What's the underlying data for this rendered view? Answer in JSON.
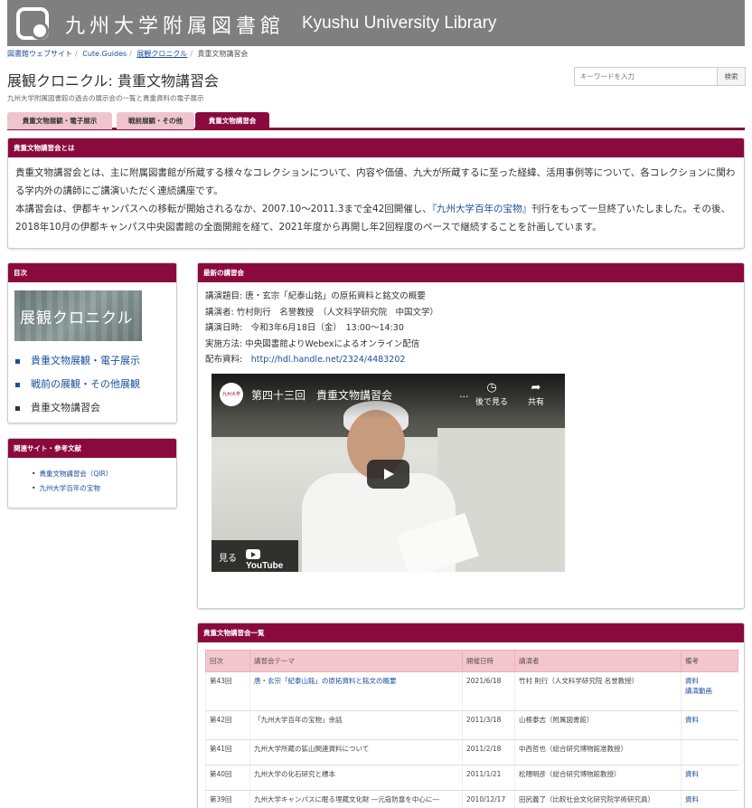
{
  "header": {
    "logo_jp": "九州大学附属図書館",
    "logo_en": "Kyushu University Library"
  },
  "breadcrumb": [
    "図書館ウェブサイト",
    "Cute.Guides",
    "展観クロニクル",
    "貴重文物講習会"
  ],
  "page": {
    "title": "展観クロニクル: 貴重文物講習会",
    "description": "九州大学附属図書館の過去の展示会の一覧と貴重資料の電子展示"
  },
  "search": {
    "placeholder": "キーワードを入力",
    "button_label": "検索"
  },
  "tabs": [
    {
      "label": "貴重文物展観・電子展示",
      "active": false
    },
    {
      "label": "戦前展観・その他",
      "active": false
    },
    {
      "label": "貴重文物講習会",
      "active": true
    }
  ],
  "about": {
    "heading": "貴重文物講習会とは",
    "paragraph1": "貴重文物講習会とは、主に附属図書館が所蔵する様々なコレクションについて、内容や価値、九大が所蔵するに至った経緯、活用事例等について、各コレクションに関わる学内外の講師にご講演いただく連続講座です。",
    "paragraph2_a": "本講習会は、伊都キャンパスへの移転が開始されるなか、2007.10～2011.3まで全42回開催し、",
    "paragraph2_link": "『九州大学百年の宝物』",
    "paragraph2_b": "刊行をもって一旦終了いたしました。その後、2018年10月の伊都キャンパス中央図書館の全面開館を経て、2021年度から再開し年2回程度のペースで継続することを計画しています。"
  },
  "toc": {
    "heading": "目次",
    "banner_text": "展観クロニクル",
    "items": [
      {
        "label": "貴重文物展観・電子展示",
        "current": false
      },
      {
        "label": "戦前の展観・その他展観",
        "current": false
      },
      {
        "label": "貴重文物講習会",
        "current": true
      }
    ]
  },
  "related": {
    "heading": "関連サイト・参考文献",
    "items": [
      "貴重文物講習会（QIR）",
      "九州大学百年の宝物"
    ]
  },
  "latest": {
    "heading": "最新の講習会",
    "topic": "講演題目: 唐・玄宗「紀泰山銘」の原拓資料と銘文の概要",
    "lecturer": "講演者: 竹村則行　名誉教授　（人文科学研究院　中国文学）",
    "datetime": "講演日時:　令和3年6月18日（金）　13:00～14:30",
    "method": "実施方法: 中央図書館よりWebexによるオンライン配信",
    "material_label": "配布資料:",
    "material_link": "http://hdl.handle.net/2324/4483202",
    "video": {
      "channel_logo": "九州大学",
      "title": "第四十三回　貴重文物講習会",
      "more": "...",
      "watch_later": "後で見る",
      "share": "共有",
      "watch_on": "見る",
      "youtube": "YouTube"
    }
  },
  "list": {
    "heading": "貴重文物講習会一覧",
    "columns": [
      "回次",
      "講習会テーマ",
      "開催日時",
      "講演者",
      "備考"
    ],
    "rows": [
      {
        "no": "第43回",
        "theme": "唐・玄宗「紀泰山銘」の原拓資料と銘文の概要",
        "date": "2021/6/18",
        "speaker": "竹村 則行（人文科学研究院 名誉教授）",
        "note1": "資料",
        "note2": "講演動画",
        "theme_link": true
      },
      {
        "no": "第42回",
        "theme": "「九州大学百年の宝物」余話",
        "date": "2011/3/18",
        "speaker": "山根泰志（附属図書館）",
        "note1": "資料",
        "note2": "",
        "theme_link": false
      },
      {
        "no": "第41回",
        "theme": "九州大学所蔵の鉱山関連資料について",
        "date": "2011/2/18",
        "speaker": "中西哲也（総合研究博物館准教授）",
        "note1": "",
        "note2": "",
        "theme_link": false
      },
      {
        "no": "第40回",
        "theme": "九州大学の化石研究と標本",
        "date": "2011/1/21",
        "speaker": "松隈明彦（総合研究博物館教授）",
        "note1": "資料",
        "note2": "",
        "theme_link": false
      },
      {
        "no": "第39回",
        "theme": "九州大学キャンパスに眠る埋蔵文化財 ―元寇防塁を中心に―",
        "date": "2010/12/17",
        "speaker": "田尻義了（比較社会文化研究院学術研究員）",
        "note1": "資料",
        "note2": "",
        "theme_link": false
      }
    ]
  },
  "colors": {
    "brand": "#8a0a3d",
    "banner": "#7f7f7f",
    "tab_inactive": "#f0c4cf",
    "table_header": "#f5c6cc",
    "link": "#1a4fa0"
  }
}
